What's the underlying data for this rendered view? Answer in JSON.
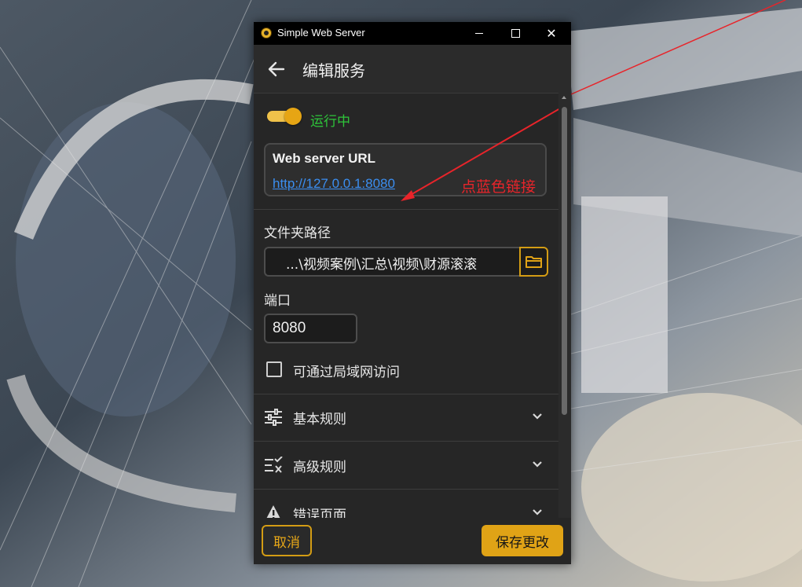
{
  "window": {
    "title": "Simple Web Server",
    "minimize_icon": "minimize-icon",
    "maximize_icon": "maximize-icon",
    "close_icon": "close-icon"
  },
  "header": {
    "title": "编辑服务",
    "back_icon": "arrow-left-icon"
  },
  "status": {
    "running": true,
    "label": "运行中",
    "color": "#2ec53a"
  },
  "url_card": {
    "label": "Web server URL",
    "link": "http://127.0.0.1:8080",
    "annotation": "点蓝色链接",
    "annotation_color": "#e8242a"
  },
  "folder": {
    "label": "文件夹路径",
    "value": "...\\视频案例\\汇总\\视频\\财源滚滚",
    "button_icon": "folder-icon"
  },
  "port": {
    "label": "端口",
    "value": "8080"
  },
  "lan_access": {
    "checked": false,
    "label": "可通过局域网访问"
  },
  "sections": [
    {
      "label": "基本规则",
      "icon": "sliders-icon"
    },
    {
      "label": "高级规则",
      "icon": "rules-check-icon"
    },
    {
      "label": "错误页面",
      "icon": "alert-icon"
    }
  ],
  "actions": {
    "cancel": "取消",
    "save": "保存更改"
  },
  "colors": {
    "accent": "#e0a316",
    "panel": "#262626",
    "link": "#3b8ef0"
  }
}
